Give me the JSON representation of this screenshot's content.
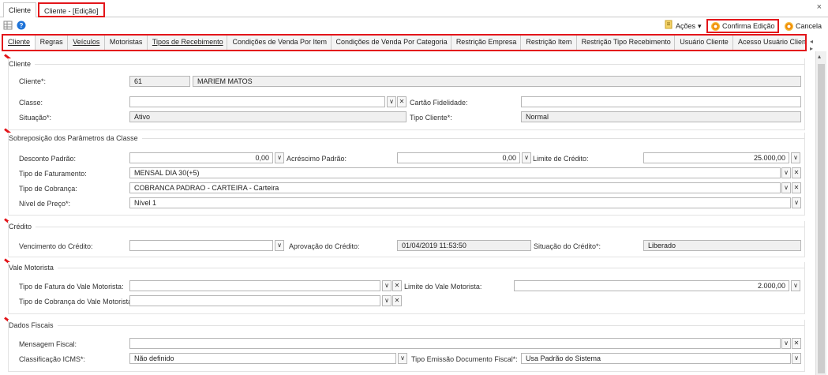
{
  "doc_tabs": {
    "tab1": "Cliente",
    "tab2": "Cliente - [Edição]"
  },
  "toolbar": {
    "acoes": "Ações",
    "acoes_caret": "▾",
    "confirma": "Confirma Edição",
    "cancela": "Cancela",
    "close": "×"
  },
  "sub_tabs": [
    "Cliente",
    "Regras",
    "Veículos",
    "Motoristas",
    "Tipos de Recebimento",
    "Condições de Venda Por Item",
    "Condições de Venda Por Categoria",
    "Restrição Empresa",
    "Restrição Item",
    "Restrição Tipo Recebimento",
    "Usuário Cliente",
    "Acesso Usuário Cliente"
  ],
  "scroll_arrows": "◂ ▸",
  "cliente": {
    "title": "Cliente",
    "cliente_label": "Cliente*:",
    "cliente_code": "61",
    "cliente_name": "MARIEM MATOS",
    "classe_label": "Classe:",
    "classe_value": "",
    "cartao_label": "Cartão Fidelidade:",
    "cartao_value": "",
    "situacao_label": "Situação*:",
    "situacao_value": "Ativo",
    "tipo_cliente_label": "Tipo Cliente*:",
    "tipo_cliente_value": "Normal"
  },
  "sobreposicao": {
    "title": "Sobreposição dos Parâmetros da Classe",
    "desconto_label": "Desconto Padrão:",
    "desconto_value": "0,00",
    "acrescimo_label": "Acréscimo Padrão:",
    "acrescimo_value": "0,00",
    "limite_label": "Limite de Crédito:",
    "limite_value": "25.000,00",
    "tipo_fat_label": "Tipo de Faturamento:",
    "tipo_fat_value": "MENSAL DIA 30(+5)",
    "tipo_cob_label": "Tipo de Cobrança:",
    "tipo_cob_value": "COBRANCA PADRAO - CARTEIRA - Carteira",
    "nivel_label": "Nível de Preço*:",
    "nivel_value": "Nível 1"
  },
  "credito": {
    "title": "Crédito",
    "venc_label": "Vencimento do Crédito:",
    "venc_value": "",
    "aprov_label": "Aprovação do Crédito:",
    "aprov_value": "01/04/2019 11:53:50",
    "sit_label": "Situação do Crédito*:",
    "sit_value": "Liberado"
  },
  "vale": {
    "title": "Vale Motorista",
    "tipo_fat_label": "Tipo de Fatura do Vale Motorista:",
    "tipo_fat_value": "",
    "limite_label": "Limite do Vale Motorista:",
    "limite_value": "2.000,00",
    "tipo_cob_label": "Tipo de Cobrança do Vale Motorista:",
    "tipo_cob_value": ""
  },
  "fiscais": {
    "title": "Dados Fiscais",
    "msg_label": "Mensagem Fiscal:",
    "msg_value": "",
    "class_label": "Classificação ICMS*:",
    "class_value": "Não definido",
    "tipo_emissao_label": "Tipo Emissão Documento Fiscal*:",
    "tipo_emissao_value": "Usa Padrão do Sistema"
  },
  "icons": {
    "grid": "grid-icon",
    "help": "help-icon",
    "acoes": "actions-icon",
    "confirm": "confirm-icon",
    "cancel": "cancel-icon",
    "dropdown": "chevron-down-icon",
    "clear": "clear-icon"
  },
  "colors": {
    "highlight": "#e3151a",
    "readonly_bg": "#f0f0f0",
    "accent": "#f08a00"
  }
}
